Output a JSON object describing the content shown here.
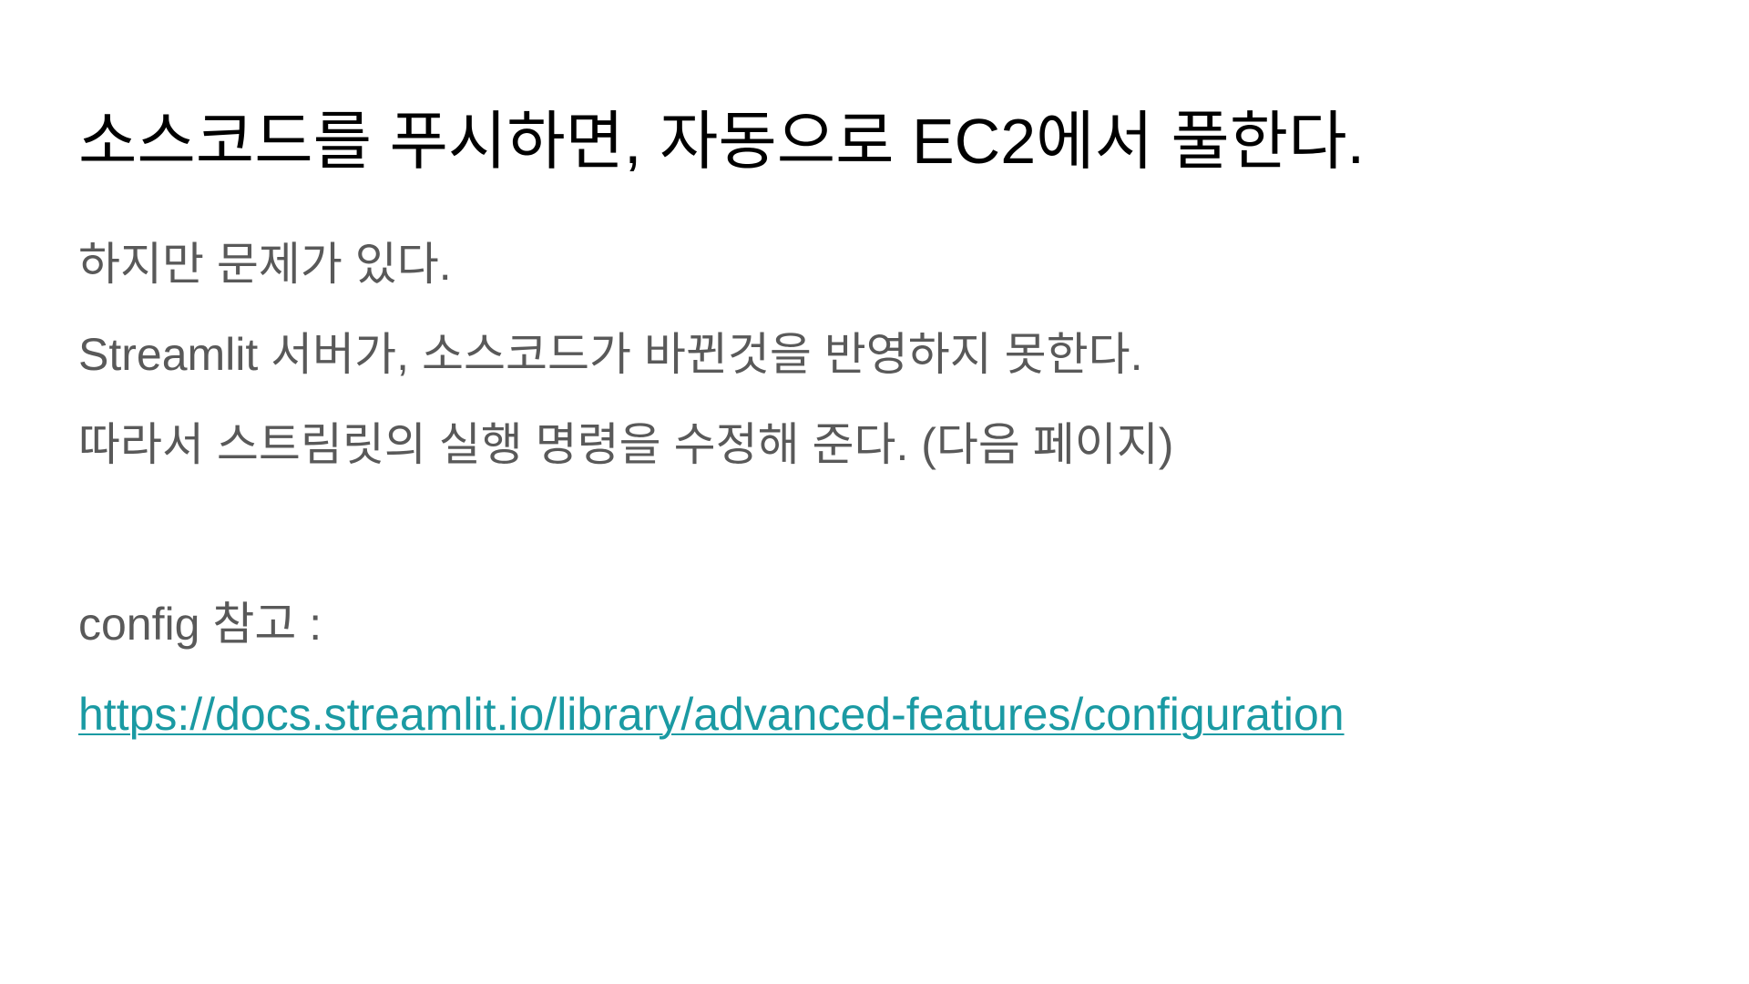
{
  "slide": {
    "title": "소스코드를 푸시하면, 자동으로 EC2에서 풀한다.",
    "lines": [
      "하지만 문제가 있다.",
      "Streamlit 서버가, 소스코드가 바뀐것을 반영하지 못한다.",
      "따라서 스트림릿의 실행 명령을 수정해 준다. (다음 페이지)"
    ],
    "config_label": "config 참고 :",
    "config_link": "https://docs.streamlit.io/library/advanced-features/configuration"
  },
  "colors": {
    "title": "#000000",
    "body": "#595959",
    "link": "#1a9aa3",
    "background": "#ffffff"
  }
}
